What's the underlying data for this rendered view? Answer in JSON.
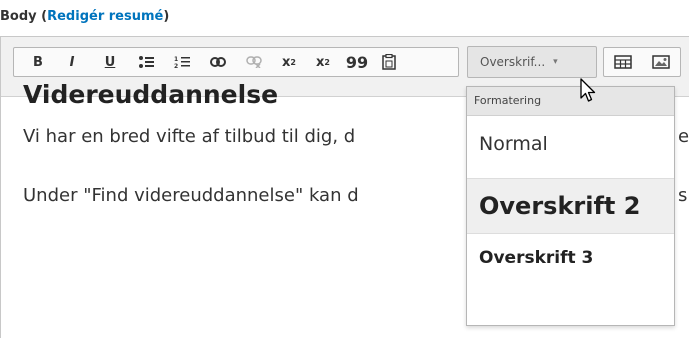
{
  "field": {
    "label": "Body",
    "link": "Redigér resumé",
    "open_paren": "(",
    "close_paren": ")"
  },
  "toolbar": {
    "buttons": [
      {
        "name": "bold-button",
        "glyph": "B"
      },
      {
        "name": "italic-button",
        "glyph": "I"
      },
      {
        "name": "underline-button",
        "glyph": "U"
      },
      {
        "name": "bulleted-list-button",
        "glyph": "•≡"
      },
      {
        "name": "numbered-list-button",
        "glyph": "1≡"
      },
      {
        "name": "link-button",
        "glyph": "⊖"
      },
      {
        "name": "unlink-button",
        "glyph": "⊘"
      },
      {
        "name": "superscript-button",
        "glyph": "x²"
      },
      {
        "name": "subscript-button",
        "glyph": "x₂"
      },
      {
        "name": "blockquote-button",
        "glyph": "99"
      },
      {
        "name": "paste-word-button",
        "glyph": "📋"
      }
    ],
    "format_combo": "Overskrif...",
    "format_arrow": "▾",
    "table_icon": "table-icon",
    "image_icon": "image-icon"
  },
  "content": {
    "heading": "Videreuddannelse",
    "para1": "Vi har en bred vifte af tilbud til dig, d",
    "para1_tail": "e",
    "para2": "Under \"Find videreuddannelse\" kan d",
    "para2_tail": "s"
  },
  "dropdown": {
    "header": "Formatering",
    "items": [
      "Normal",
      "Overskrift 2",
      "Overskrift 3"
    ],
    "selected_index": 1
  }
}
